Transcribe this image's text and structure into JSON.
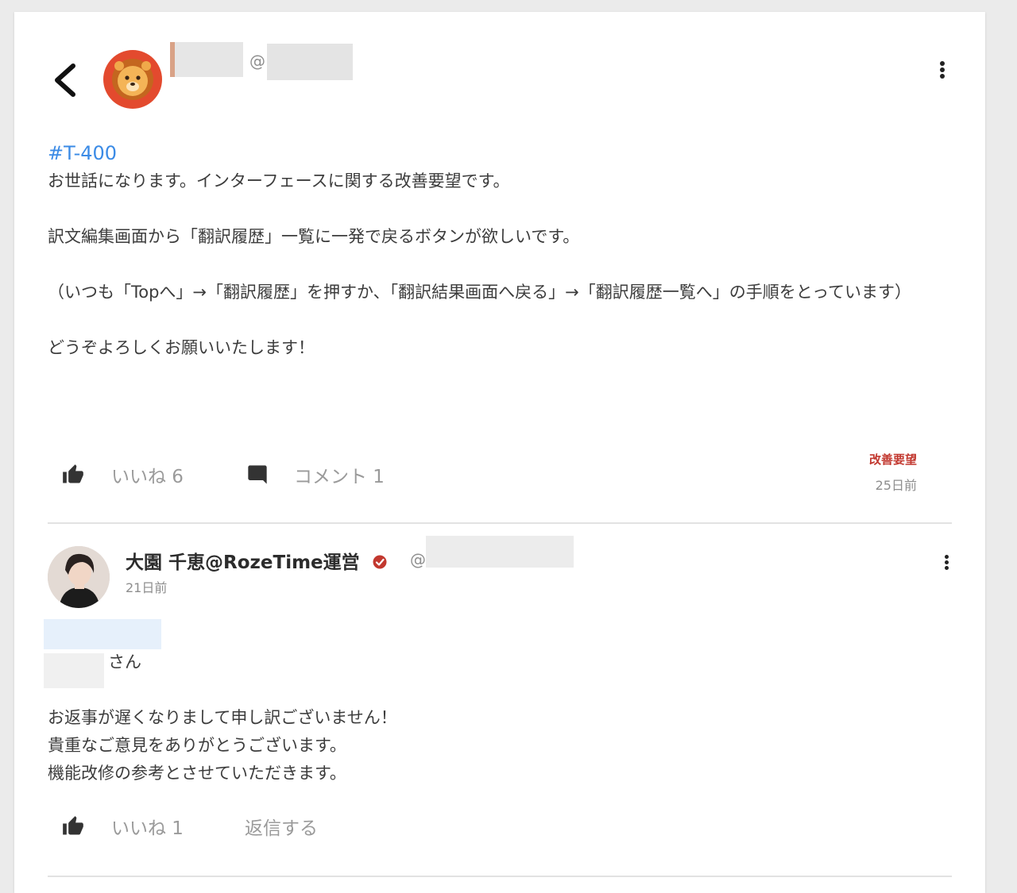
{
  "post": {
    "handle_prefix": "@",
    "hashtag": "#T-400",
    "lines": [
      "お世話になります。インターフェースに関する改善要望です。",
      "訳文編集画面から「翻訳履歴」一覧に一発で戻るボタンが欲しいです。",
      "（いつも「Topへ」→「翻訳履歴」を押すか、「翻訳結果画面へ戻る」→「翻訳履歴一覧へ」の手順をとっています）",
      "どうぞよろしくお願いいたします！"
    ],
    "like_label": "いいね 6",
    "comment_label": "コメント 1",
    "category": "改善要望",
    "time_ago": "25日前"
  },
  "comment": {
    "author": "大園 千恵@RozeTime運営",
    "handle_prefix": "@",
    "time_ago": "21日前",
    "salutation": "さん",
    "lines": [
      "お返事が遅くなりまして申し訳ございません！",
      "貴重なご意見をありがとうございます。",
      "機能改修の参考とさせていただきます。"
    ],
    "like_label": "いいね 1",
    "reply_label": "返信する"
  },
  "icons": [
    "back-icon",
    "lion-avatar",
    "more-vert-icon",
    "thumbs-up-icon",
    "comment-icon",
    "verified-icon"
  ],
  "colors": {
    "hashtag": "#3b8be6",
    "category": "#c2382f",
    "avatar_bg": "#e34a2e"
  }
}
